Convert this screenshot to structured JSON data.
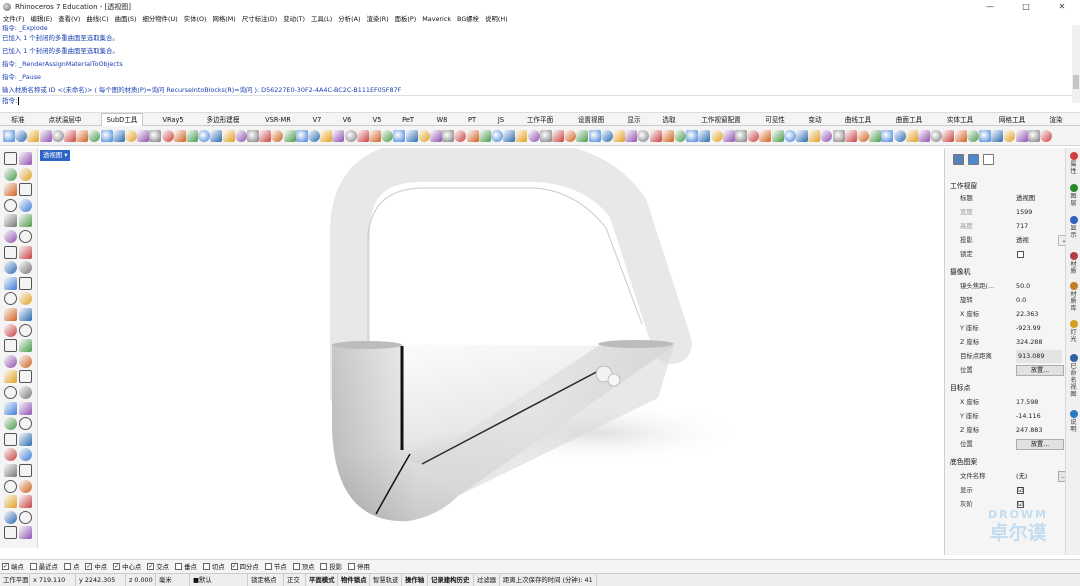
{
  "window": {
    "title": "Rhinoceros 7 Education - [透视图]",
    "controls": [
      "—",
      "□",
      "✕"
    ]
  },
  "menu": [
    "文件(F)",
    "编辑(E)",
    "查看(V)",
    "曲线(C)",
    "曲面(S)",
    "细分物件(U)",
    "实体(O)",
    "网格(M)",
    "尺寸标注(D)",
    "变动(T)",
    "工具(L)",
    "分析(A)",
    "渲染(R)",
    "面板(P)",
    "Maverick",
    "BG螺栓",
    "说明(H)"
  ],
  "history": {
    "partial": "指令: _Explode",
    "lines": [
      "已加入 1 个封闭的多重曲面至选取集合。",
      "已加入 1 个封闭的多重曲面至选取集合。",
      "指令: _RenderAssignMaterialToObjects",
      "指令: _Pause",
      "输入材质名称或 ID <(未命名)> ( 每个图的材质(P)=询问  RecurseIntoBlocks(R)=询问 ): D56227E0-30F2-4A4C-BC2C-B111EF05F87F"
    ],
    "prompt": "指令:"
  },
  "tabs": [
    "标准",
    "点状温层中",
    "SubD工具",
    "VRay5",
    "多边形建模",
    "VSR-MR",
    "V7",
    "V6",
    "V5",
    "PeT",
    "W8",
    "PT",
    "JS",
    "工作平面",
    "设置视图",
    "显示",
    "选取",
    "工作视窗配置",
    "可见性",
    "变动",
    "曲线工具",
    "曲面工具",
    "实体工具",
    "网格工具",
    "渲染"
  ],
  "active_tab": "SubD工具",
  "viewport": {
    "label": "透视图 ▾"
  },
  "properties": {
    "section_view": "工作视窗",
    "view_rows": [
      {
        "k": "标题",
        "v": "透视图"
      },
      {
        "k": "宽度",
        "v": "1599"
      },
      {
        "k": "高度",
        "v": "717"
      },
      {
        "k": "投影",
        "v": "透视"
      },
      {
        "k": "锁定",
        "v": ""
      }
    ],
    "section_camera": "摄像机",
    "camera_rows": [
      {
        "k": "镜头焦距(...",
        "v": "50.0"
      },
      {
        "k": "旋转",
        "v": "0.0"
      },
      {
        "k": "X 座标",
        "v": "22.363"
      },
      {
        "k": "Y 座标",
        "v": "-923.99"
      },
      {
        "k": "Z 座标",
        "v": "324.288"
      },
      {
        "k": "目标点距离",
        "v": "913.089"
      },
      {
        "k": "位置",
        "v": "放置..."
      }
    ],
    "section_target": "目标点",
    "target_rows": [
      {
        "k": "X 座标",
        "v": "17.598"
      },
      {
        "k": "Y 座标",
        "v": "-14.116"
      },
      {
        "k": "Z 座标",
        "v": "247.883"
      },
      {
        "k": "位置",
        "v": "放置..."
      }
    ],
    "section_wallpaper": "底色图案",
    "wallpaper_rows": [
      {
        "k": "文件名称",
        "v": "(无)"
      },
      {
        "k": "显示",
        "v": "☑"
      },
      {
        "k": "灰阶",
        "v": "☑"
      }
    ],
    "dots": "..."
  },
  "side_tabs": [
    "属性",
    "图层",
    "显示",
    "材质",
    "材质库",
    "灯光",
    "已命名视图",
    "说明"
  ],
  "side_colors": [
    "#d04040",
    "#2a8a2a",
    "#3060c0",
    "#b04040",
    "#c08020",
    "#d4a020",
    "#3060a0",
    "#2a7ac0"
  ],
  "osnaps": [
    {
      "label": "端点",
      "on": true
    },
    {
      "label": "最近点",
      "on": false
    },
    {
      "label": "点",
      "on": false
    },
    {
      "label": "中点",
      "on": true
    },
    {
      "label": "中心点",
      "on": true
    },
    {
      "label": "交点",
      "on": true
    },
    {
      "label": "垂点",
      "on": false
    },
    {
      "label": "切点",
      "on": false
    },
    {
      "label": "四分点",
      "on": true
    },
    {
      "label": "节点",
      "on": false
    },
    {
      "label": "顶点",
      "on": false
    },
    {
      "label": "投影",
      "on": false
    },
    {
      "label": "停用",
      "on": false
    }
  ],
  "status": [
    "工作平面",
    "x 719.110",
    "y 2242.305",
    "z 0.000",
    "毫米",
    "■默认",
    "锁定格点",
    "正交",
    "平面模式",
    "物件锁点",
    "智慧轨迹",
    "操作轴",
    "记录建构历史",
    "过滤器",
    "距离上次保存的时间 (分钟): 41"
  ],
  "status_bold": [
    "平面模式",
    "物件锁点",
    "操作轴",
    "记录建构历史"
  ],
  "watermark": {
    "top": "DROWM",
    "bottom": "卓尔谟"
  }
}
